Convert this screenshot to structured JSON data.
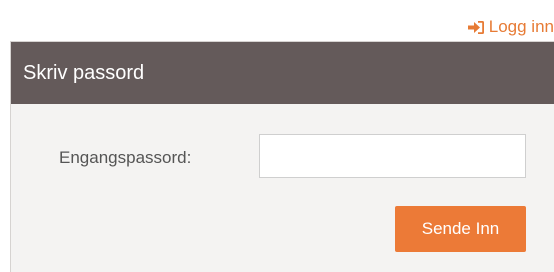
{
  "header": {
    "login_label": "Logg inn",
    "login_icon": "sign-in-icon",
    "accent_color": "#e77b35"
  },
  "panel": {
    "title": "Skriv passord",
    "header_color": "#645a5a",
    "background_color": "#f4f3f2"
  },
  "form": {
    "field_label": "Engangspassord:",
    "field_value": "",
    "field_placeholder": "",
    "submit_label": "Sende Inn",
    "submit_color": "#ec7a37"
  }
}
